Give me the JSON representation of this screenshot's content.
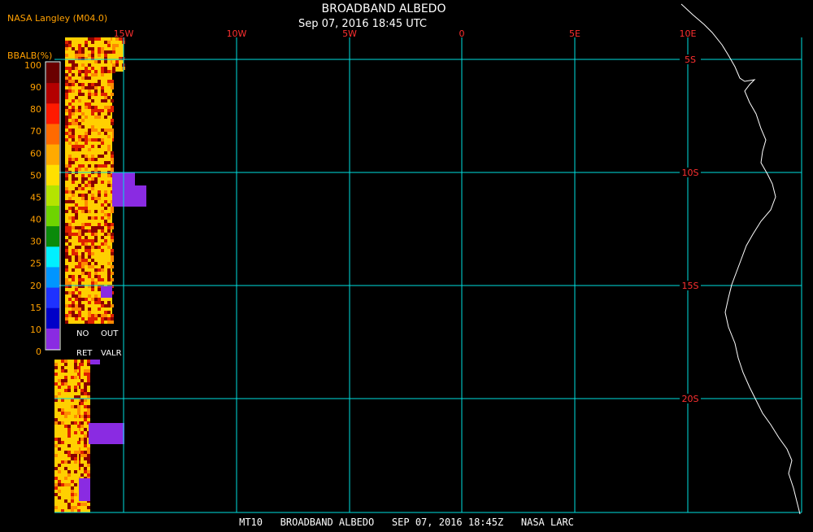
{
  "header": {
    "credit": "NASA Langley (M04.0)",
    "title": "BROADBAND ALBEDO",
    "subtitle": "Sep 07, 2016 18:45 UTC"
  },
  "footer": {
    "caption": "MT10   BROADBAND ALBEDO   SEP 07, 2016 18:45Z   NASA LARC"
  },
  "legend": {
    "unit_label": "BBALB(%)",
    "ticks": [
      "100",
      "90",
      "80",
      "70",
      "60",
      "50",
      "45",
      "40",
      "30",
      "25",
      "20",
      "15",
      "10",
      "0"
    ],
    "colors": [
      "#6a0000",
      "#b40000",
      "#ff1a00",
      "#ff6a00",
      "#ffaa00",
      "#ffe000",
      "#b4e400",
      "#6ed400",
      "#0a8a0a",
      "#00f0ff",
      "#0095ff",
      "#1e32ff",
      "#0000c8",
      "#8a2be2"
    ],
    "no_ret_label_1": "NO",
    "no_ret_label_2": "RET",
    "out_valr_label_1": "OUT",
    "out_valr_label_2": "VALR",
    "no_ret_color": "#000000",
    "out_valr_color": "#000000"
  },
  "grid": {
    "color": "#00e0e0",
    "label_color": "#ff3030",
    "lon_labels": [
      "15W",
      "10W",
      "5W",
      "0",
      "5E",
      "10E"
    ],
    "lat_labels": [
      "5S",
      "10S",
      "15S",
      "20S"
    ]
  },
  "data_colors": {
    "swath_hot": [
      "#ffd000",
      "#ff8a00",
      "#e02000",
      "#8a0000"
    ],
    "no_ret_fill": "#8a2be2"
  }
}
